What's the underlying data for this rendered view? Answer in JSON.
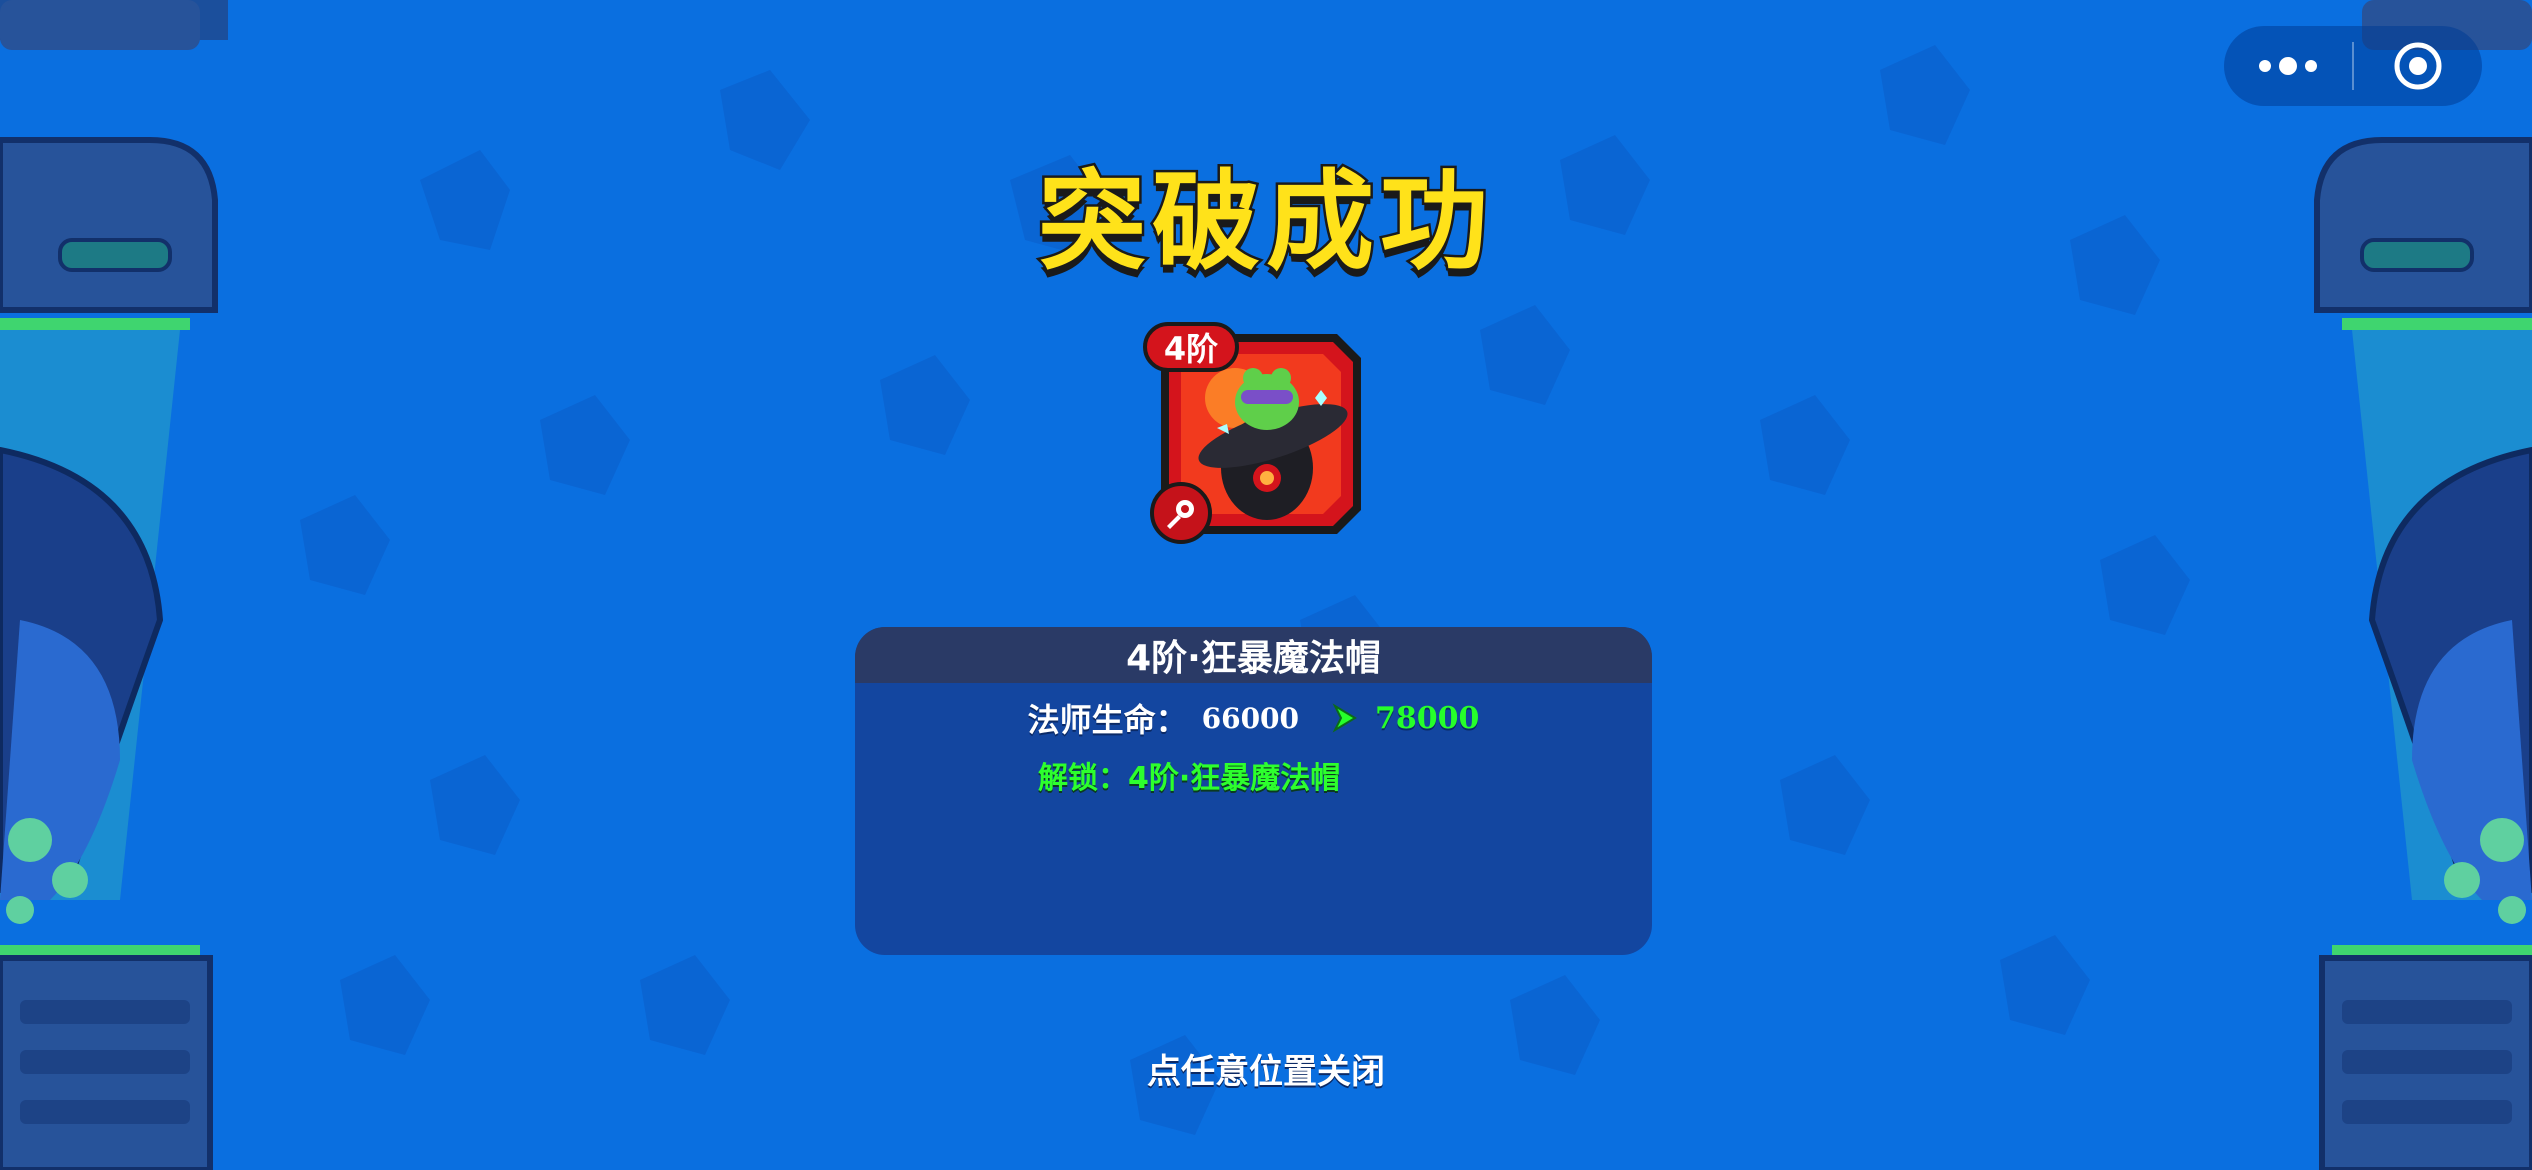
{
  "title": "突破成功",
  "item": {
    "tier_badge": "4阶",
    "icon_name": "magic-hat-frog-icon",
    "key_icon_name": "key-icon",
    "frame_color": "#d4141c"
  },
  "panel": {
    "header": "4阶·狂暴魔法帽",
    "stat": {
      "label": "法师生命：",
      "old_value": "66000",
      "new_value": "78000",
      "arrow_icon": "arrow-right-icon"
    },
    "unlock": "解锁：4阶·狂暴魔法帽"
  },
  "hint": "点任意位置关闭",
  "system_capsule": {
    "more_icon": "more-dots-icon",
    "close_icon": "target-close-icon"
  },
  "colors": {
    "background": "#0a6fe0",
    "title": "#ffe21a",
    "panel": "#1346a0",
    "panel_header": "#2a3a66",
    "new_value": "#26ff2a"
  }
}
